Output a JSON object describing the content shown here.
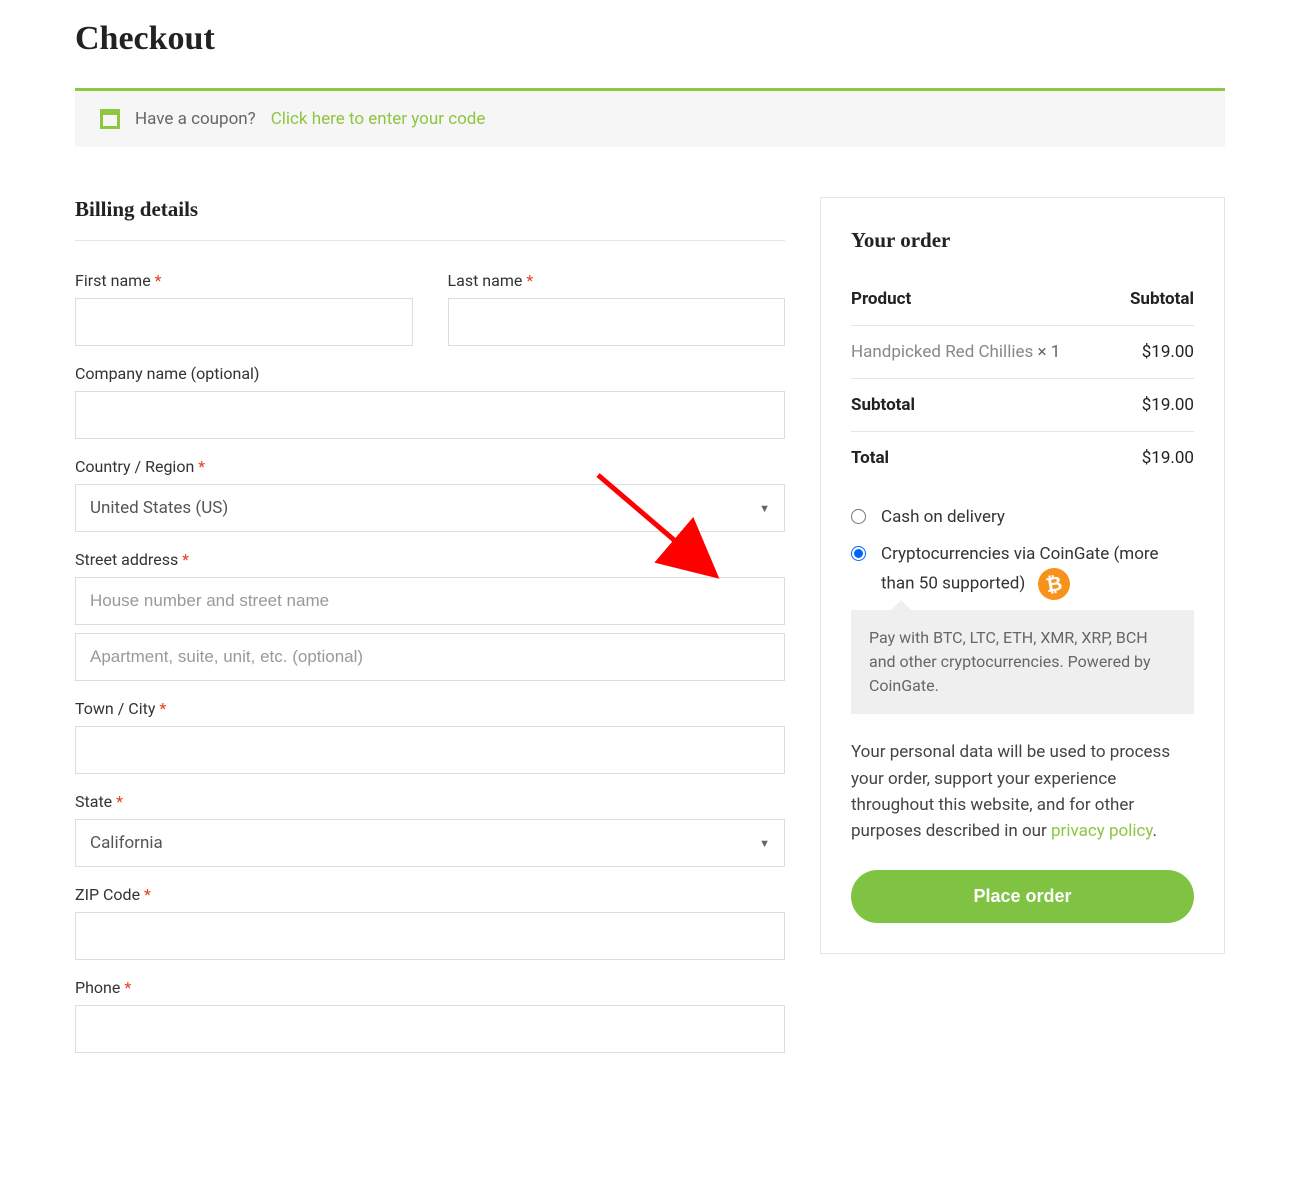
{
  "page_title": "Checkout",
  "coupon": {
    "prompt": "Have a coupon?",
    "link": "Click here to enter your code"
  },
  "billing": {
    "heading": "Billing details",
    "first_name_label": "First name",
    "last_name_label": "Last name",
    "company_label": "Company name (optional)",
    "country_label": "Country / Region",
    "country_value": "United States (US)",
    "street_label": "Street address",
    "street_placeholder": "House number and street name",
    "street2_placeholder": "Apartment, suite, unit, etc. (optional)",
    "city_label": "Town / City",
    "state_label": "State",
    "state_value": "California",
    "zip_label": "ZIP Code",
    "phone_label": "Phone"
  },
  "order": {
    "heading": "Your order",
    "product_header": "Product",
    "subtotal_header": "Subtotal",
    "item_name": "Handpicked Red Chillies",
    "item_qty": "× 1",
    "item_price": "$19.00",
    "subtotal_label": "Subtotal",
    "subtotal_value": "$19.00",
    "total_label": "Total",
    "total_value": "$19.00"
  },
  "payments": {
    "cod_label": "Cash on delivery",
    "crypto_label": "Cryptocurrencies via CoinGate (more than 50 supported)",
    "crypto_desc": "Pay with BTC, LTC, ETH, XMR, XRP, BCH and other cryptocurrencies. Powered by CoinGate."
  },
  "privacy": {
    "text_before": "Your personal data will be used to process your order, support your experience throughout this website, and for other purposes described in our ",
    "link": "privacy policy",
    "text_after": "."
  },
  "place_order_label": "Place order",
  "required_mark": "*"
}
